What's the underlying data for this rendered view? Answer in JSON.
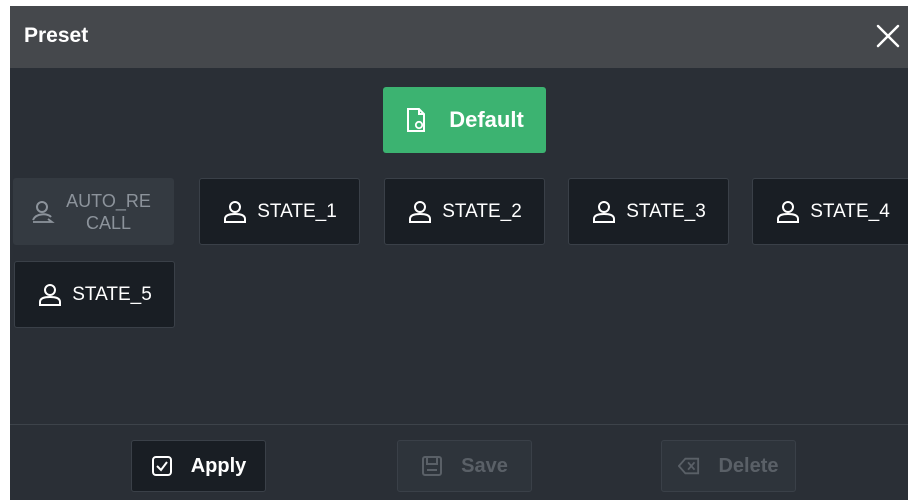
{
  "dialog": {
    "title": "Preset",
    "close_icon": "close-icon"
  },
  "default_button": {
    "label": "Default",
    "icon": "document-settings-icon",
    "color": "#3cb371"
  },
  "states": [
    {
      "label": "AUTO_RE\nCALL",
      "line1": "AUTO_RE",
      "line2": "CALL",
      "icon": "user-recall-icon",
      "enabled": false
    },
    {
      "label": "STATE_1",
      "icon": "user-icon",
      "enabled": true
    },
    {
      "label": "STATE_2",
      "icon": "user-icon",
      "enabled": true
    },
    {
      "label": "STATE_3",
      "icon": "user-icon",
      "enabled": true
    },
    {
      "label": "STATE_4",
      "icon": "user-icon",
      "enabled": true
    },
    {
      "label": "STATE_5",
      "icon": "user-icon",
      "enabled": true
    }
  ],
  "footer": {
    "apply": {
      "label": "Apply",
      "icon": "checkbox-checked-icon",
      "enabled": true
    },
    "save": {
      "label": "Save",
      "icon": "save-icon",
      "enabled": false
    },
    "delete": {
      "label": "Delete",
      "icon": "backspace-delete-icon",
      "enabled": false
    }
  }
}
